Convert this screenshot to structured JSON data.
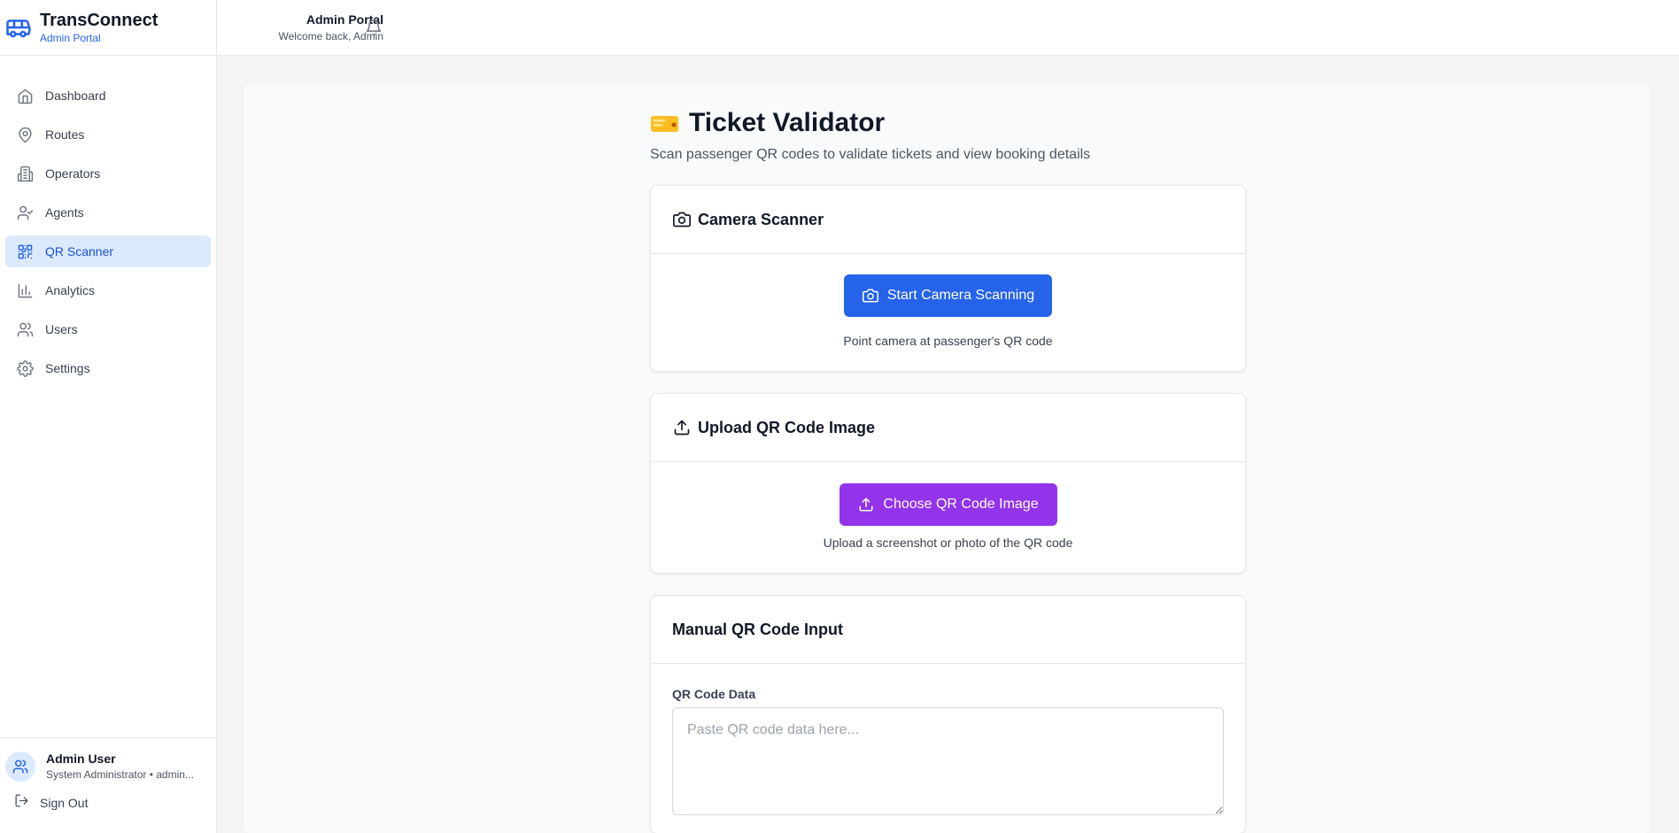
{
  "brand": {
    "title": "TransConnect",
    "subtitle": "Admin Portal",
    "icon": "bus-icon",
    "accent_color": "#2563eb"
  },
  "sidebar": {
    "items": [
      {
        "label": "Dashboard",
        "icon": "home-icon",
        "active": false
      },
      {
        "label": "Routes",
        "icon": "map-pin-icon",
        "active": false
      },
      {
        "label": "Operators",
        "icon": "building-icon",
        "active": false
      },
      {
        "label": "Agents",
        "icon": "user-check-icon",
        "active": false
      },
      {
        "label": "QR Scanner",
        "icon": "qr-code-icon",
        "active": true
      },
      {
        "label": "Analytics",
        "icon": "bar-chart-icon",
        "active": false
      },
      {
        "label": "Users",
        "icon": "users-icon",
        "active": false
      },
      {
        "label": "Settings",
        "icon": "gear-icon",
        "active": false
      }
    ],
    "active_bg": "#dbeafe",
    "active_color": "#1d4ed8"
  },
  "user": {
    "name": "Admin User",
    "role": "System Administrator • admin...",
    "sign_out": "Sign Out"
  },
  "header": {
    "title": "Admin Portal",
    "subtitle": "Welcome back, Admin",
    "bell_icon": "bell-icon"
  },
  "page": {
    "title": "Ticket Validator",
    "title_icon": "ticket-icon",
    "description": "Scan passenger QR codes to validate tickets and view booking details"
  },
  "camera_card": {
    "title": "Camera Scanner",
    "button": "Start Camera Scanning",
    "hint": "Point camera at passenger's QR code",
    "button_color": "#2563eb"
  },
  "upload_card": {
    "title": "Upload QR Code Image",
    "button": "Choose QR Code Image",
    "hint": "Upload a screenshot or photo of the QR code",
    "button_color": "#9333ea"
  },
  "manual_card": {
    "title": "Manual QR Code Input",
    "field_label": "QR Code Data",
    "placeholder": "Paste QR code data here...",
    "value": ""
  }
}
